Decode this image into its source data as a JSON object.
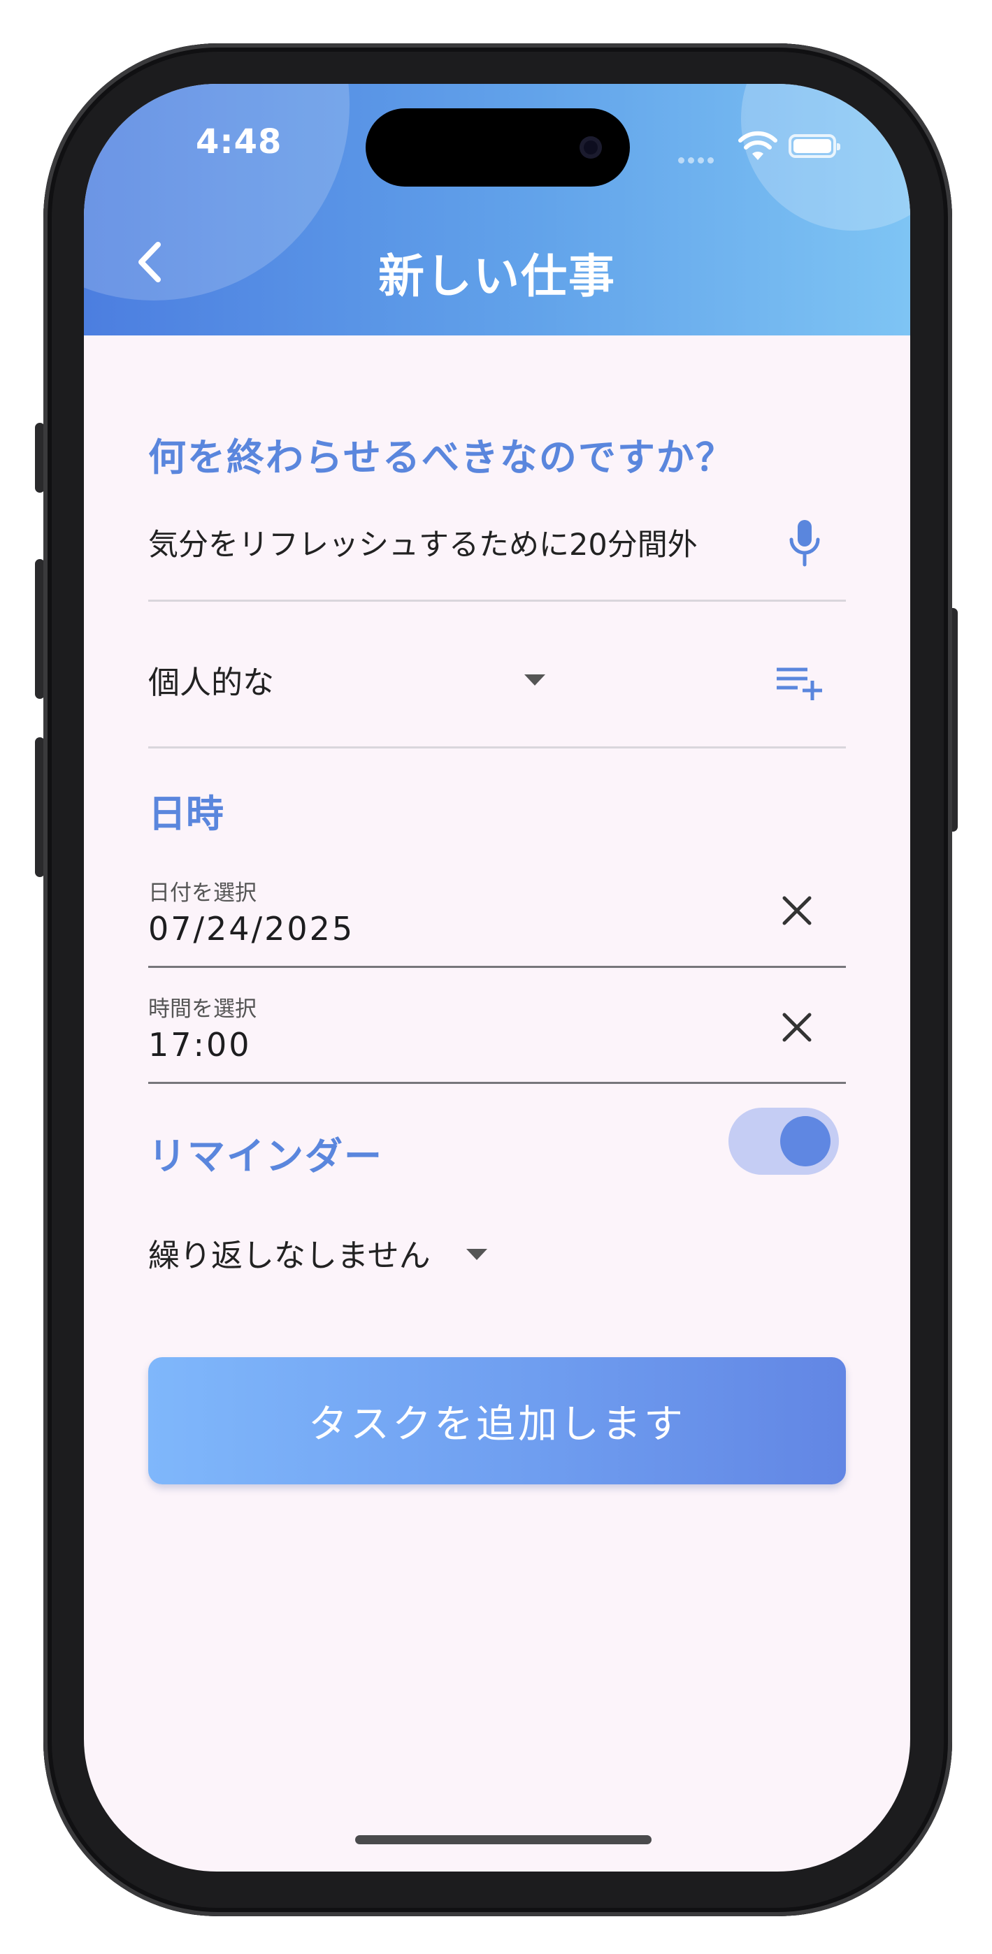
{
  "status_bar": {
    "time": "4:48"
  },
  "header": {
    "title": "新しい仕事",
    "back_icon": "chevron-left-icon"
  },
  "form": {
    "question": "何を終わらせるべきなのですか？",
    "task_text": "気分をリフレッシュするために20分間外",
    "category": "個人的な",
    "datetime_section": "日時",
    "date_label": "日付を選択",
    "date_value": "07/24/2025",
    "time_label": "時間を選択",
    "time_value": "17:00",
    "reminder_label": "リマインダー",
    "reminder_on": true,
    "repeat": "繰り返しなしません",
    "submit": "タスクを追加します"
  },
  "colors": {
    "accent": "#5a86dd",
    "header_gradient_start": "#4c7ee0",
    "header_gradient_end": "#7ec4f4",
    "background": "#fcf4fa"
  }
}
